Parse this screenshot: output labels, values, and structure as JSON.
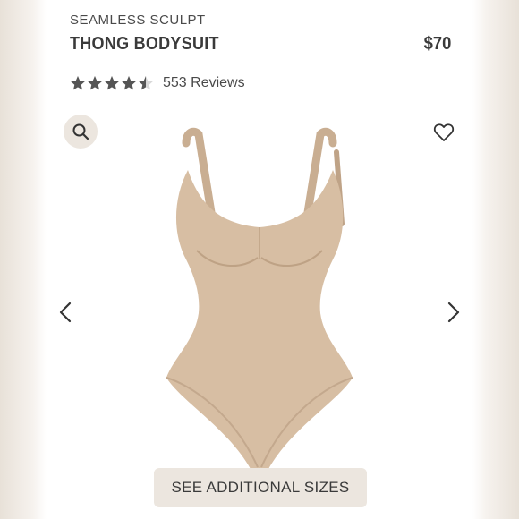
{
  "product": {
    "collection": "SEAMLESS SCULPT",
    "name": "THONG BODYSUIT",
    "price": "$70",
    "rating": 4.5,
    "rating_max": 5,
    "reviews": "553 Reviews",
    "color": "#d7bea3"
  },
  "icons": {
    "zoom": "search-icon",
    "wishlist": "heart-icon",
    "prev": "chevron-left-icon",
    "next": "chevron-right-icon",
    "star": "star-icon"
  },
  "actions": {
    "sizes_label": "SEE ADDITIONAL SIZES"
  }
}
